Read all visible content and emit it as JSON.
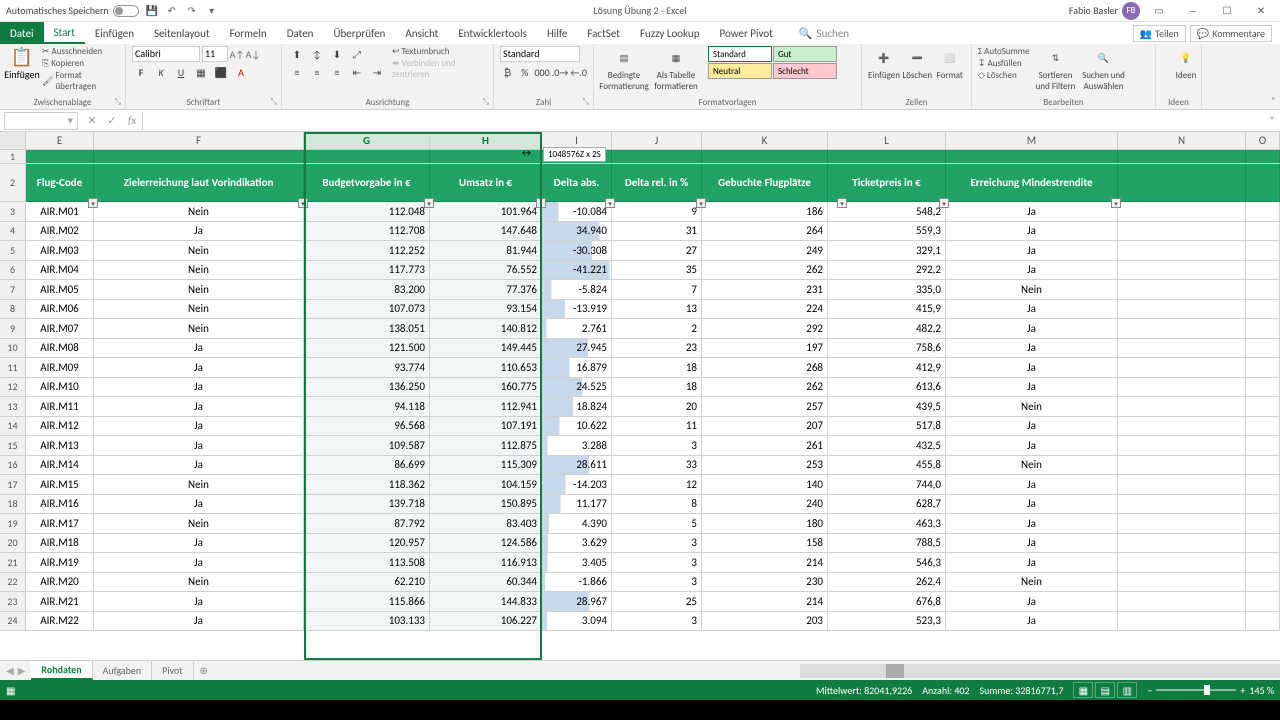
{
  "title_bar": {
    "autosave_label": "Automatisches Speichern",
    "document_title": "Lösung Übung 2 - Excel",
    "user_name": "Fabio Basler",
    "user_initials": "FB"
  },
  "ribbon_tabs": {
    "file": "Datei",
    "tabs": [
      "Start",
      "Einfügen",
      "Seitenlayout",
      "Formeln",
      "Daten",
      "Überprüfen",
      "Ansicht",
      "Entwicklertools",
      "Hilfe",
      "FactSet",
      "Fuzzy Lookup",
      "Power Pivot"
    ],
    "search_placeholder": "Suchen",
    "share": "Teilen",
    "comments": "Kommentare"
  },
  "ribbon": {
    "clipboard": {
      "paste": "Einfügen",
      "cut": "Ausschneiden",
      "copy": "Kopieren",
      "format_painter": "Format übertragen",
      "label": "Zwischenablage"
    },
    "font": {
      "name": "Calibri",
      "size": "11",
      "label": "Schriftart"
    },
    "align": {
      "wrap": "Textumbruch",
      "merge": "Verbinden und zentrieren",
      "label": "Ausrichtung"
    },
    "number": {
      "format": "Standard",
      "label": "Zahl"
    },
    "styles": {
      "cond": "Bedingte Formatierung",
      "table": "Als Tabelle formatieren",
      "standard": "Standard",
      "gut": "Gut",
      "neutral": "Neutral",
      "schlecht": "Schlecht",
      "label": "Formatvorlagen"
    },
    "cells": {
      "insert": "Einfügen",
      "delete": "Löschen",
      "format": "Format",
      "label": "Zellen"
    },
    "editing": {
      "sum": "AutoSumme",
      "fill": "Ausfüllen",
      "clear": "Löschen",
      "sort": "Sortieren und Filtern",
      "find": "Suchen und Auswählen",
      "label": "Bearbeiten"
    },
    "ideas": {
      "label": "Ideen",
      "btn": "Ideen"
    }
  },
  "resize_tooltip": "1048576Z x 2S",
  "columns": [
    "E",
    "F",
    "G",
    "H",
    "I",
    "J",
    "K",
    "L",
    "M",
    "N",
    "O"
  ],
  "selected_cols": [
    "G",
    "H"
  ],
  "name_box": "",
  "table": {
    "headers": [
      "Flug-Code",
      "Zielerreichung laut Vorindikation",
      "Budgetvorgabe in €",
      "Umsatz in €",
      "Delta abs.",
      "Delta rel. in %",
      "Gebuchte Flugplätze",
      "Ticketpreis in €",
      "Erreichung Mindestrendite"
    ],
    "rows": [
      [
        "AIR.M01",
        "Nein",
        "112.048",
        "101.964",
        "-10.084",
        "9",
        "186",
        "548,2",
        "Ja"
      ],
      [
        "AIR.M02",
        "Ja",
        "112.708",
        "147.648",
        "34.940",
        "31",
        "264",
        "559,3",
        "Ja"
      ],
      [
        "AIR.M03",
        "Nein",
        "112.252",
        "81.944",
        "-30.308",
        "27",
        "249",
        "329,1",
        "Ja"
      ],
      [
        "AIR.M04",
        "Nein",
        "117.773",
        "76.552",
        "-41.221",
        "35",
        "262",
        "292,2",
        "Ja"
      ],
      [
        "AIR.M05",
        "Nein",
        "83.200",
        "77.376",
        "-5.824",
        "7",
        "231",
        "335,0",
        "Nein"
      ],
      [
        "AIR.M06",
        "Nein",
        "107.073",
        "93.154",
        "-13.919",
        "13",
        "224",
        "415,9",
        "Ja"
      ],
      [
        "AIR.M07",
        "Nein",
        "138.051",
        "140.812",
        "2.761",
        "2",
        "292",
        "482,2",
        "Ja"
      ],
      [
        "AIR.M08",
        "Ja",
        "121.500",
        "149.445",
        "27.945",
        "23",
        "197",
        "758,6",
        "Ja"
      ],
      [
        "AIR.M09",
        "Ja",
        "93.774",
        "110.653",
        "16.879",
        "18",
        "268",
        "412,9",
        "Ja"
      ],
      [
        "AIR.M10",
        "Ja",
        "136.250",
        "160.775",
        "24.525",
        "18",
        "262",
        "613,6",
        "Ja"
      ],
      [
        "AIR.M11",
        "Ja",
        "94.118",
        "112.941",
        "18.824",
        "20",
        "257",
        "439,5",
        "Nein"
      ],
      [
        "AIR.M12",
        "Ja",
        "96.568",
        "107.191",
        "10.622",
        "11",
        "207",
        "517,8",
        "Ja"
      ],
      [
        "AIR.M13",
        "Ja",
        "109.587",
        "112.875",
        "3.288",
        "3",
        "261",
        "432,5",
        "Ja"
      ],
      [
        "AIR.M14",
        "Ja",
        "86.699",
        "115.309",
        "28.611",
        "33",
        "253",
        "455,8",
        "Nein"
      ],
      [
        "AIR.M15",
        "Nein",
        "118.362",
        "104.159",
        "-14.203",
        "12",
        "140",
        "744,0",
        "Ja"
      ],
      [
        "AIR.M16",
        "Ja",
        "139.718",
        "150.895",
        "11.177",
        "8",
        "240",
        "628,7",
        "Ja"
      ],
      [
        "AIR.M17",
        "Nein",
        "87.792",
        "83.403",
        "4.390",
        "5",
        "180",
        "463,3",
        "Ja"
      ],
      [
        "AIR.M18",
        "Ja",
        "120.957",
        "124.586",
        "3.629",
        "3",
        "158",
        "788,5",
        "Ja"
      ],
      [
        "AIR.M19",
        "Ja",
        "113.508",
        "116.913",
        "3.405",
        "3",
        "214",
        "546,3",
        "Ja"
      ],
      [
        "AIR.M20",
        "Nein",
        "62.210",
        "60.344",
        "-1.866",
        "3",
        "230",
        "262,4",
        "Nein"
      ],
      [
        "AIR.M21",
        "Ja",
        "115.866",
        "144.833",
        "28.967",
        "25",
        "214",
        "676,8",
        "Ja"
      ],
      [
        "AIR.M22",
        "Ja",
        "103.133",
        "106.227",
        "3.094",
        "3",
        "203",
        "523,3",
        "Ja"
      ]
    ]
  },
  "sheet_tabs": [
    "Rohdaten",
    "Aufgaben",
    "Pivot"
  ],
  "active_sheet": "Rohdaten",
  "status_bar": {
    "avg": "Mittelwert: 82041,9226",
    "count": "Anzahl: 402",
    "sum": "Summe: 32816771,7",
    "zoom": "145 %"
  }
}
